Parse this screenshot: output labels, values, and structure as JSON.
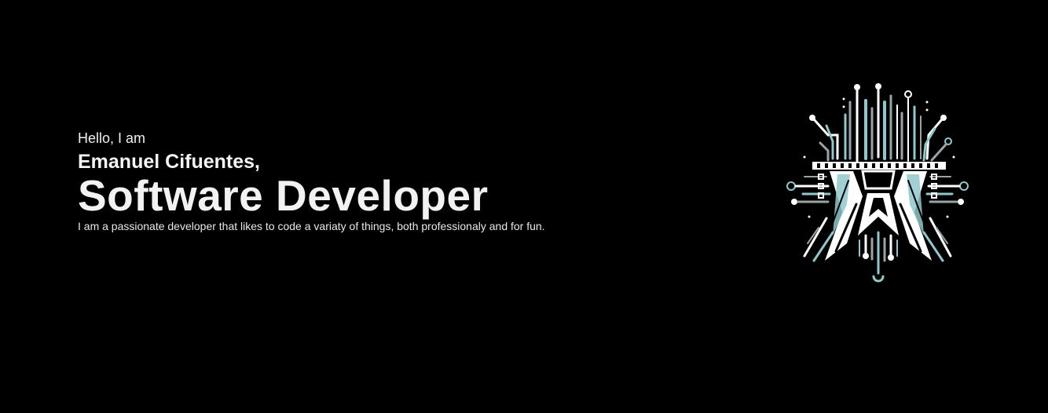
{
  "hero": {
    "greeting": "Hello, I am",
    "name": "Emanuel Cifuentes,",
    "role": "Software Developer",
    "tagline": "I am a passionate developer that likes to code a variaty of things, both professionaly and for fun."
  },
  "logo": {
    "icon": "circuit-board-logo-icon",
    "colors": {
      "primary": "#ffffff",
      "accent": "#8fc7cc",
      "secondary": "#9aa3a8",
      "background": "#000000"
    }
  }
}
